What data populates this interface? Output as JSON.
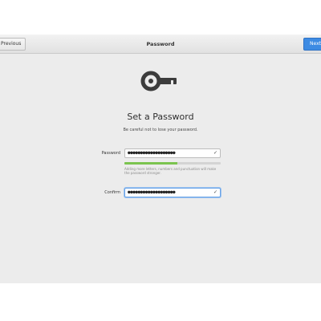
{
  "header": {
    "title": "Password",
    "previous_label": "Previous",
    "next_label": "Next"
  },
  "main": {
    "title": "Set a Password",
    "subtitle": "Be careful not to lose your password.",
    "password": {
      "label": "Password",
      "value": "●●●●●●●●●●●●●●●●●●●",
      "hint": "Adding more letters, numbers and punctuation will make the password stronger.",
      "strength": 0.55
    },
    "confirm": {
      "label": "Confirm",
      "value": "●●●●●●●●●●●●●●●●●●●"
    },
    "check_icon": "✓"
  },
  "colors": {
    "accent": "#3d8be3",
    "strength": "#7bc44f",
    "window_bg": "#ececec"
  }
}
